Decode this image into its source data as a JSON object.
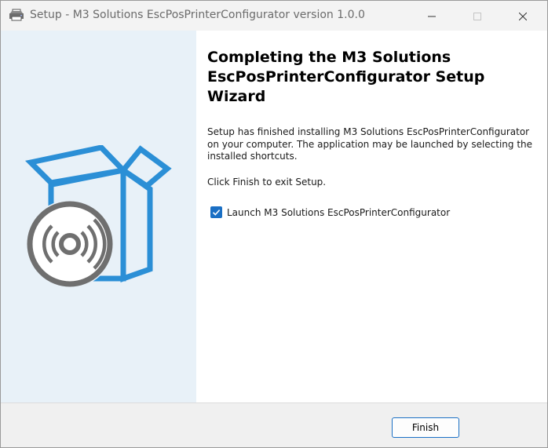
{
  "window": {
    "title": "Setup - M3 Solutions EscPosPrinterConfigurator version 1.0.0"
  },
  "titlebar_icons": {
    "app": "printer-icon",
    "minimize": "minimize-icon",
    "maximize": "maximize-icon",
    "close": "close-icon"
  },
  "wizard": {
    "art_icon": "software-box-with-disc-icon",
    "heading": "Completing the M3 Solutions EscPosPrinterConfigurator Setup Wizard",
    "finished_text": "Setup has finished installing M3 Solutions EscPosPrinterConfigurator on your computer. The application may be launched by selecting the installed shortcuts.",
    "click_finish_text": "Click Finish to exit Setup.",
    "launch_checkbox": {
      "label": "Launch M3 Solutions EscPosPrinterConfigurator",
      "checked": true
    }
  },
  "footer": {
    "finish_label": "Finish"
  },
  "colors": {
    "accent": "#1a6fc4",
    "art_blue": "#2b8fd6",
    "left_panel_bg": "#e8f1f8",
    "footer_bg": "#f0f0f0"
  }
}
